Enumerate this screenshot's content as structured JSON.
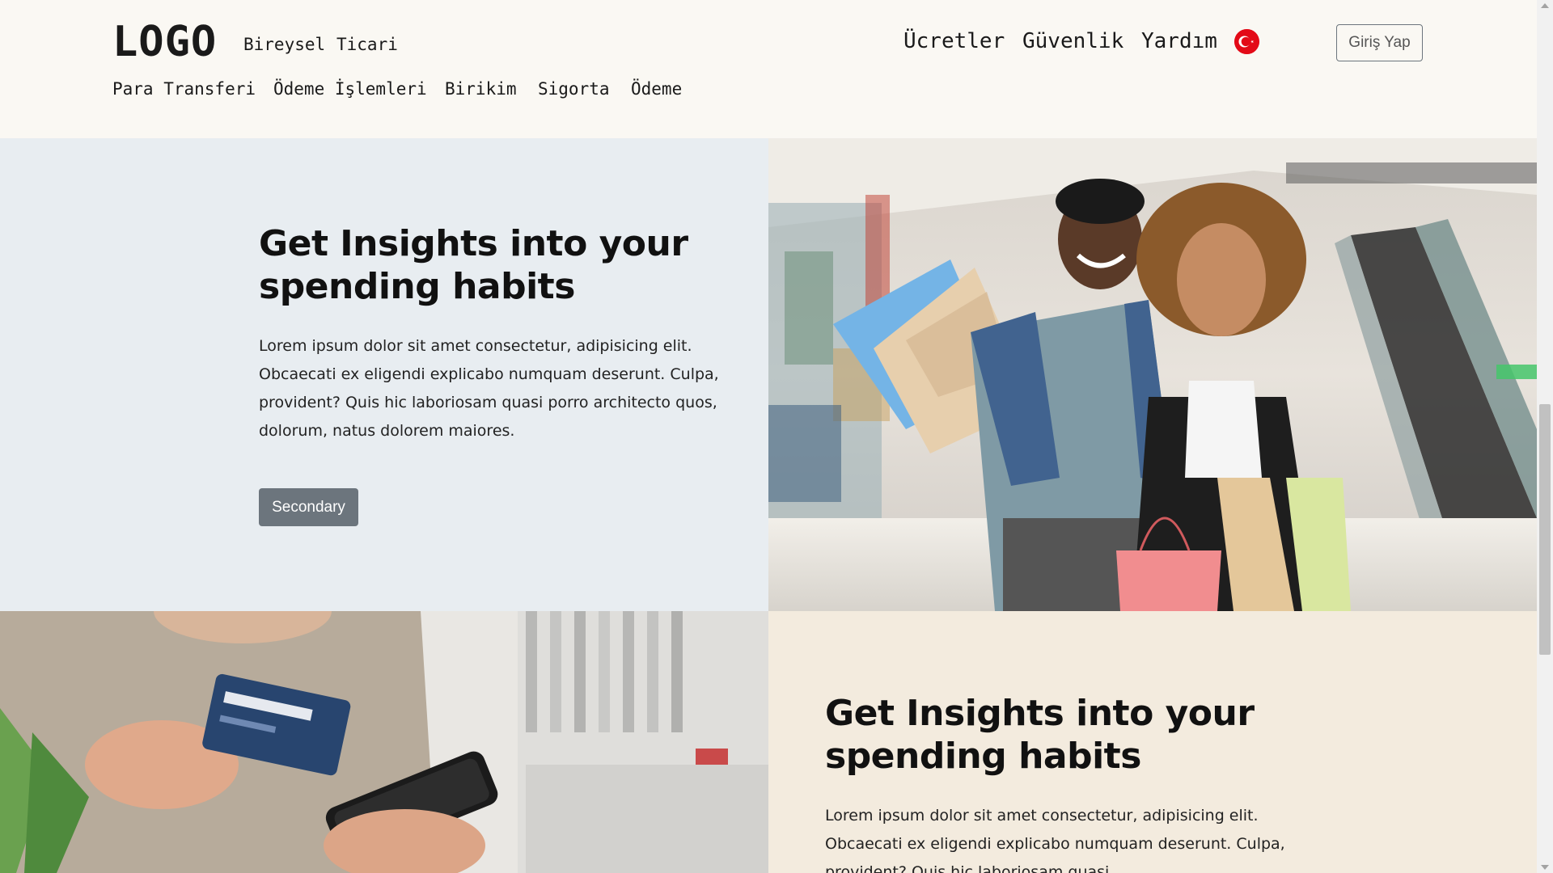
{
  "header": {
    "logo": "LOGO",
    "segments": [
      "Bireysel",
      "Ticari"
    ],
    "top_nav": [
      "Ücretler",
      "Güvenlik",
      "Yardım"
    ],
    "language_flag": "turkey-flag-icon",
    "login_label": "Giriş Yap",
    "sub_nav": [
      "Para Transferi",
      "Ödeme İşlemleri",
      "Birikim",
      "Sigorta",
      "Ödeme"
    ]
  },
  "sections": [
    {
      "title": "Get Insights into your spending habits",
      "body": "Lorem ipsum dolor sit amet consectetur, adipisicing elit. Obcaecati ex eligendi explicabo numquam deserunt. Culpa, provident? Quis hic laboriosam quasi porro architecto quos, dolorum, natus dolorem maiores.",
      "button_label": "Secondary"
    },
    {
      "title": "Get Insights into your spending habits",
      "body": "Lorem ipsum dolor sit amet consectetur, adipisicing elit. Obcaecati ex eligendi explicabo numquam deserunt. Culpa, provident? Quis hic laboriosam quasi"
    }
  ],
  "colors": {
    "header_bg": "#faf8f3",
    "panel_blue": "#e8edf1",
    "panel_beige": "#f3ebde",
    "button_secondary": "#6c757d",
    "flag_red": "#e30a17"
  }
}
